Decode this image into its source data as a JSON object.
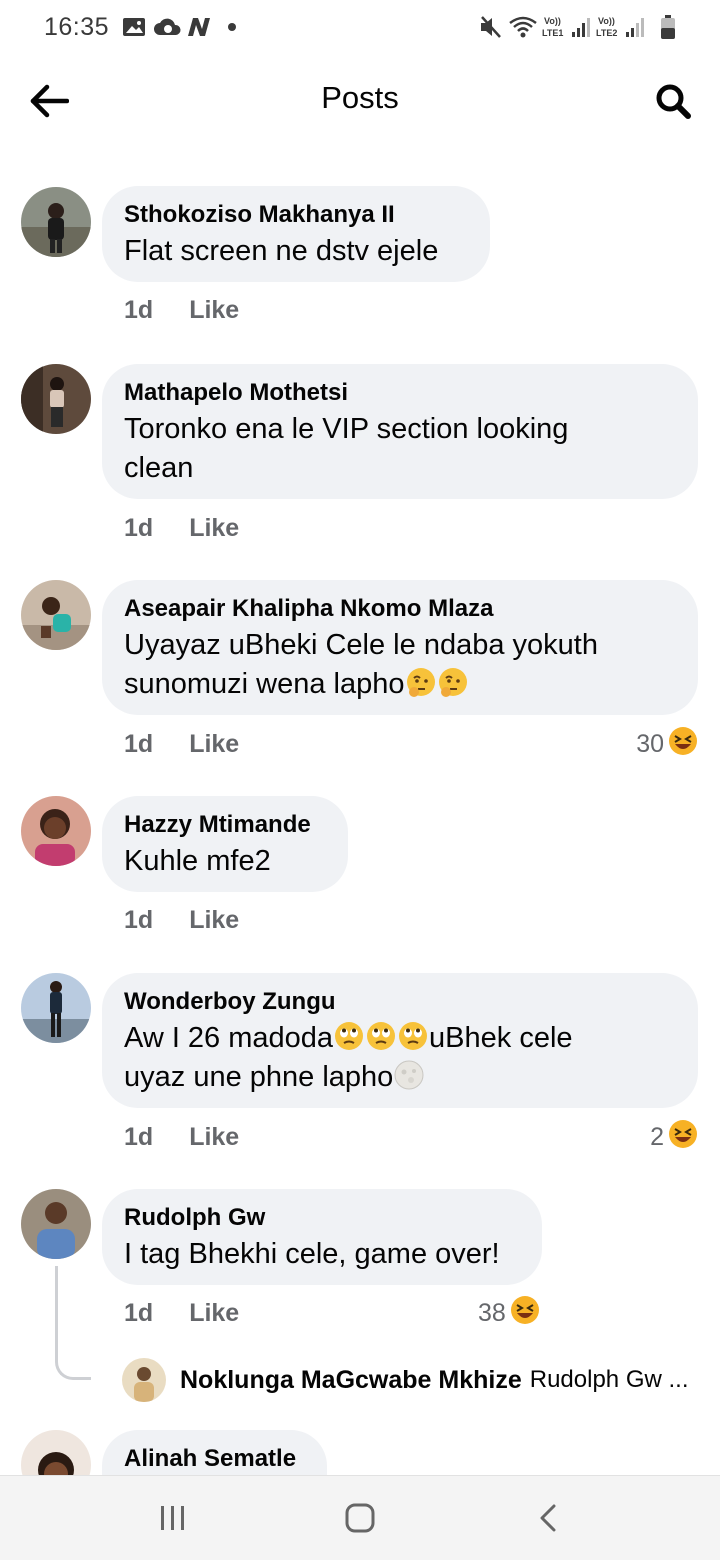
{
  "status_bar": {
    "time": "16:35",
    "icons": [
      "gallery-icon",
      "cloud-icon",
      "n-app-icon",
      "dot-icon",
      "mute-icon",
      "wifi-icon",
      "lte1-signal-icon",
      "lte2-signal-icon",
      "battery-icon"
    ],
    "lte1_label": "Vo)) LTE1",
    "lte2_label": "Vo)) LTE2"
  },
  "app_bar": {
    "title": "Posts",
    "back_icon": "back-arrow-icon",
    "search_icon": "search-icon"
  },
  "comments": [
    {
      "name": "Sthokoziso Makhanya II",
      "text": "Flat screen  ne dstv ejele",
      "time": "1d",
      "like": "Like",
      "reactions": ""
    },
    {
      "name": "Mathapelo Mothetsi",
      "text_line1": "Toronko ena le VIP section looking",
      "text_line2": "clean",
      "time": "1d",
      "like": "Like",
      "reactions": ""
    },
    {
      "name": "Aseapair Khalipha Nkomo Mlaza",
      "text_line1": "Uyayaz uBheki Cele le ndaba yokuth",
      "text_line2": "sunomuzi wena lapho",
      "time": "1d",
      "like": "Like",
      "reactions": "30"
    },
    {
      "name": "Hazzy Mtimande",
      "text": "Kuhle mfe2",
      "time": "1d",
      "like": "Like",
      "reactions": ""
    },
    {
      "name": "Wonderboy Zungu",
      "text_line1a": "Aw I 26 madoda",
      "text_line1b": "uBhek cele",
      "text_line2": "uyaz une phne lapho",
      "time": "1d",
      "like": "Like",
      "reactions": "2"
    },
    {
      "name": "Rudolph Gw",
      "text": "I tag Bhekhi cele, game over!",
      "time": "1d",
      "like": "Like",
      "reactions": "38",
      "reply": {
        "name": "Noklunga MaGcwabe Mkhize",
        "text": "Rudolph Gw ..."
      }
    },
    {
      "name": "Alinah Sematle"
    }
  ],
  "nav_bar": {
    "icons": [
      "recent-apps-icon",
      "home-icon",
      "back-icon"
    ]
  }
}
